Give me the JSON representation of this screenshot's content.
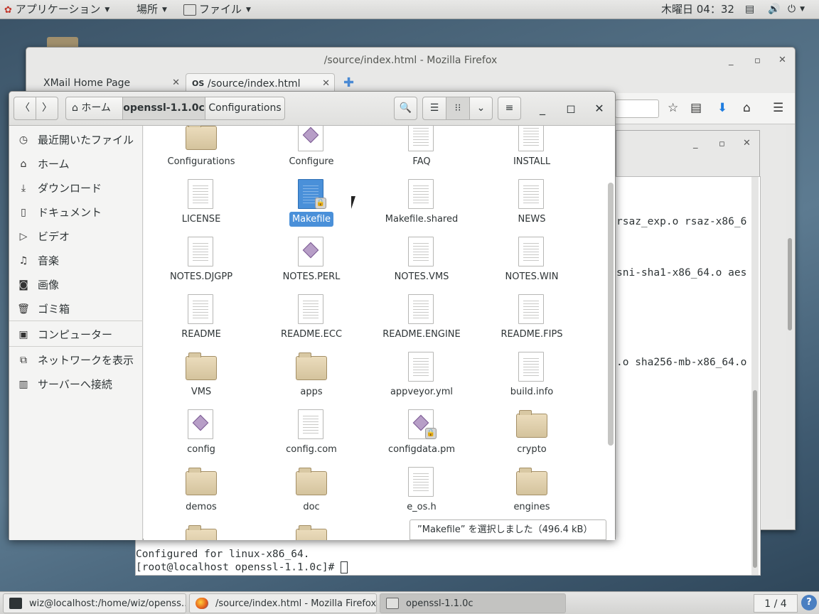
{
  "topbar": {
    "applications": "アプリケーション",
    "places": "場所",
    "file_menu": "ファイル",
    "clock": "木曜日 04：32"
  },
  "firefox": {
    "title": "/source/index.html - Mozilla Firefox",
    "tabs": [
      {
        "label": "XMail Home Page"
      },
      {
        "label": "/source/index.html",
        "favicon_text": "OS"
      }
    ]
  },
  "terminal": {
    "lines": [
      "rsaz_exp.o rsaz-x86_6",
      "sni-sha1-x86_64.o aes",
      ".o sha256-mb-x86_64.o",
      "Configured for linux-x86_64.",
      "[root@localhost openssl-1.1.0c]# "
    ]
  },
  "nautilus": {
    "breadcrumb": {
      "home": "ホーム",
      "current": "openssl-1.1.0c",
      "next": "Configurations"
    },
    "sidebar": [
      {
        "label": "最近開いたファイル",
        "icon": "clock-icon"
      },
      {
        "label": "ホーム",
        "icon": "home-icon"
      },
      {
        "label": "ダウンロード",
        "icon": "download-icon"
      },
      {
        "label": "ドキュメント",
        "icon": "document-icon"
      },
      {
        "label": "ビデオ",
        "icon": "video-icon"
      },
      {
        "label": "音楽",
        "icon": "music-icon"
      },
      {
        "label": "画像",
        "icon": "camera-icon"
      },
      {
        "label": "ゴミ箱",
        "icon": "trash-icon"
      },
      {
        "label": "コンピューター",
        "icon": "computer-icon"
      },
      {
        "label": "ネットワークを表示",
        "icon": "network-icon"
      },
      {
        "label": "サーバーへ接続",
        "icon": "server-icon"
      }
    ],
    "files": [
      {
        "name": "Configurations",
        "type": "folder"
      },
      {
        "name": "Configure",
        "type": "script"
      },
      {
        "name": "FAQ",
        "type": "text"
      },
      {
        "name": "INSTALL",
        "type": "text"
      },
      {
        "name": "LICENSE",
        "type": "text"
      },
      {
        "name": "Makefile",
        "type": "text-locked",
        "selected": true
      },
      {
        "name": "Makefile.shared",
        "type": "text"
      },
      {
        "name": "NEWS",
        "type": "text"
      },
      {
        "name": "NOTES.DJGPP",
        "type": "text"
      },
      {
        "name": "NOTES.PERL",
        "type": "script"
      },
      {
        "name": "NOTES.VMS",
        "type": "text"
      },
      {
        "name": "NOTES.WIN",
        "type": "text"
      },
      {
        "name": "README",
        "type": "text"
      },
      {
        "name": "README.ECC",
        "type": "text"
      },
      {
        "name": "README.ENGINE",
        "type": "text"
      },
      {
        "name": "README.FIPS",
        "type": "text"
      },
      {
        "name": "VMS",
        "type": "folder"
      },
      {
        "name": "apps",
        "type": "folder"
      },
      {
        "name": "appveyor.yml",
        "type": "text"
      },
      {
        "name": "build.info",
        "type": "text"
      },
      {
        "name": "config",
        "type": "script"
      },
      {
        "name": "config.com",
        "type": "text"
      },
      {
        "name": "configdata.pm",
        "type": "script-locked"
      },
      {
        "name": "crypto",
        "type": "folder"
      },
      {
        "name": "demos",
        "type": "folder"
      },
      {
        "name": "doc",
        "type": "folder"
      },
      {
        "name": "e_os.h",
        "type": "text"
      },
      {
        "name": "engines",
        "type": "folder"
      },
      {
        "name": "",
        "type": "folder"
      },
      {
        "name": "",
        "type": "folder"
      }
    ],
    "status": "”Makefile” を選択しました（496.4 kB）"
  },
  "taskbar": {
    "items": [
      {
        "label": "wiz@localhost:/home/wiz/openss…"
      },
      {
        "label": "/source/index.html - Mozilla Firefox"
      },
      {
        "label": "openssl-1.1.0c"
      }
    ],
    "pager": "1 / 4",
    "help": "?"
  }
}
